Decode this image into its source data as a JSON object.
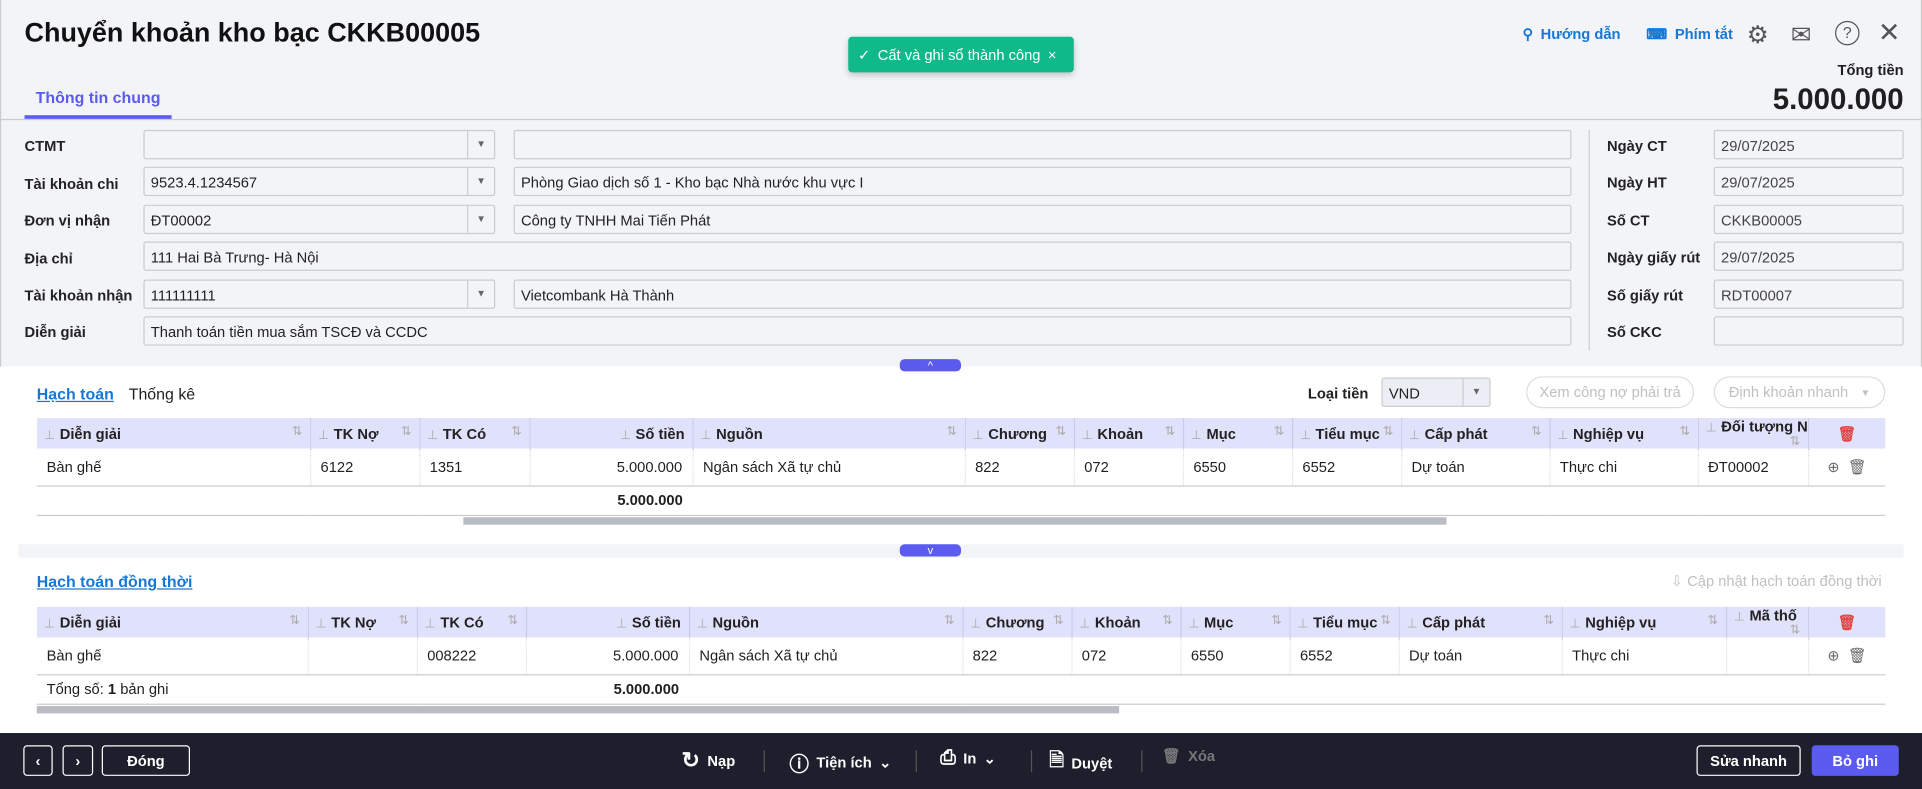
{
  "header": {
    "title": "Chuyển khoản kho bạc CKKB00005",
    "toast": "Cất và ghi sổ thành công",
    "guide": "Hướng dẫn",
    "shortcuts": "Phím tắt",
    "total_label": "Tổng tiền",
    "total_value": "5.000.000",
    "tab": "Thông tin chung"
  },
  "form": {
    "ctmt": {
      "label": "CTMT",
      "value": "",
      "name": ""
    },
    "tk_chi": {
      "label": "Tài khoản chi",
      "value": "9523.4.1234567",
      "name": "Phòng Giao dịch số 1 - Kho bạc Nhà nước khu vực I"
    },
    "don_vi": {
      "label": "Đơn vị nhận",
      "value": "ĐT00002",
      "name": "Công ty TNHH Mai Tiến Phát"
    },
    "dia_chi": {
      "label": "Địa chỉ",
      "value": "111 Hai Bà Trưng- Hà Nội"
    },
    "tk_nhan": {
      "label": "Tài khoản nhận",
      "value": "111111111",
      "name": "Vietcombank Hà Thành"
    },
    "dien_giai": {
      "label": "Diễn giải",
      "value": "Thanh toán tiền mua sắm TSCĐ và CCDC"
    },
    "right": [
      {
        "label": "Ngày CT",
        "value": "29/07/2025"
      },
      {
        "label": "Ngày HT",
        "value": "29/07/2025"
      },
      {
        "label": "Số CT",
        "value": "CKKB00005"
      },
      {
        "label": "Ngày giấy rút",
        "value": "29/07/2025"
      },
      {
        "label": "Số giấy rút",
        "value": "RDT00007"
      },
      {
        "label": "Số CKC",
        "value": ""
      }
    ]
  },
  "detail": {
    "tab1": "Hạch toán",
    "tab2": "Thống kê",
    "currency_label": "Loại tiền",
    "currency": "VND",
    "btn_debt": "Xem công nợ phải trả",
    "btn_quick": "Định khoản nhanh",
    "columns": [
      "Diễn giải",
      "TK Nợ",
      "TK Có",
      "Số tiền",
      "Nguồn",
      "Chương",
      "Khoản",
      "Mục",
      "Tiểu mục",
      "Cấp phát",
      "Nghiệp vụ",
      "Đối tượng N"
    ],
    "rows": [
      [
        "Bàn ghế",
        "6122",
        "1351",
        "5.000.000",
        "Ngân sách Xã tự chủ",
        "822",
        "072",
        "6550",
        "6552",
        "Dự toán",
        "Thực chi",
        "ĐT00002"
      ]
    ],
    "total": "5.000.000"
  },
  "concurrent": {
    "title": "Hạch toán đồng thời",
    "update": "Cập nhật hạch toán đồng thời",
    "columns": [
      "Diễn giải",
      "TK Nợ",
      "TK Có",
      "Số tiền",
      "Nguồn",
      "Chương",
      "Khoản",
      "Mục",
      "Tiểu mục",
      "Cấp phát",
      "Nghiệp vụ",
      "Mã thố"
    ],
    "rows": [
      [
        "Bàn ghế",
        "",
        "008222",
        "5.000.000",
        "Ngân sách Xã tự chủ",
        "822",
        "072",
        "6550",
        "6552",
        "Dự toán",
        "Thực chi",
        ""
      ]
    ],
    "count_label": "Tổng số:",
    "count": "1",
    "count_suffix": "bản ghi",
    "total": "5.000.000"
  },
  "footer": {
    "close": "Đóng",
    "reload": "Nạp",
    "utilities": "Tiện ích",
    "print": "In",
    "approve": "Duyệt",
    "delete": "Xóa",
    "quick_edit": "Sửa nhanh",
    "unpost": "Bỏ ghi"
  }
}
